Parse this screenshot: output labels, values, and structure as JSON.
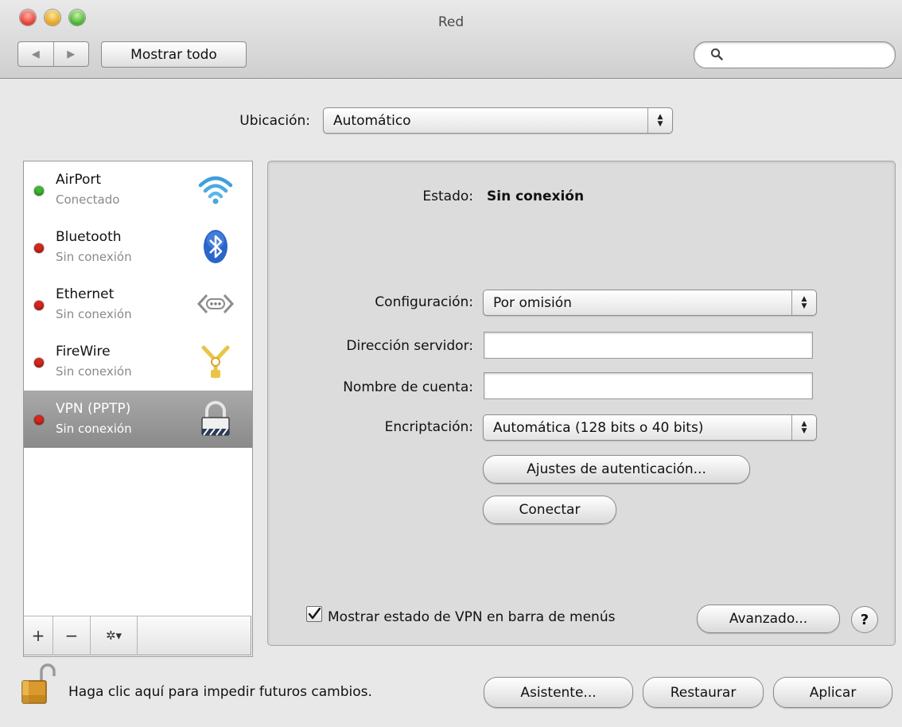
{
  "window": {
    "title": "Red"
  },
  "toolbar": {
    "back_glyph": "◀",
    "forward_glyph": "▶",
    "show_all_label": "Mostrar todo",
    "search_placeholder": "",
    "search_value": ""
  },
  "location": {
    "label": "Ubicación:",
    "value": "Automático"
  },
  "sidebar": {
    "items": [
      {
        "name": "AirPort",
        "status": "Conectado",
        "status_color": "#3cba2f",
        "icon": "wifi-icon",
        "selected": false
      },
      {
        "name": "Bluetooth",
        "status": "Sin conexión",
        "status_color": "#d9261c",
        "icon": "bluetooth-icon",
        "selected": false
      },
      {
        "name": "Ethernet",
        "status": "Sin conexión",
        "status_color": "#d9261c",
        "icon": "ethernet-icon",
        "selected": false
      },
      {
        "name": "FireWire",
        "status": "Sin conexión",
        "status_color": "#d9261c",
        "icon": "firewire-icon",
        "selected": false
      },
      {
        "name": "VPN (PPTP)",
        "status": "Sin conexión",
        "status_color": "#d9261c",
        "icon": "vpn-lock-icon",
        "selected": true
      }
    ],
    "add_glyph": "+",
    "remove_glyph": "−",
    "action_glyph": "✲▾"
  },
  "detail": {
    "status_label": "Estado:",
    "status_value": "Sin conexión",
    "configuration_label": "Configuración:",
    "configuration_value": "Por omisión",
    "server_label": "Dirección servidor:",
    "server_value": "",
    "account_label": "Nombre de cuenta:",
    "account_value": "",
    "encryption_label": "Encriptación:",
    "encryption_value": "Automática (128 bits o 40 bits)",
    "auth_button": "Ajustes de autenticación...",
    "connect_button": "Conectar",
    "show_vpn_checkbox_label": "Mostrar estado de VPN en barra de menús",
    "show_vpn_checked": true,
    "advanced_button": "Avanzado...",
    "help_glyph": "?"
  },
  "footer": {
    "lock_text": "Haga clic aquí para impedir futuros cambios.",
    "assistant_button": "Asistente...",
    "revert_button": "Restaurar",
    "apply_button": "Aplicar"
  }
}
